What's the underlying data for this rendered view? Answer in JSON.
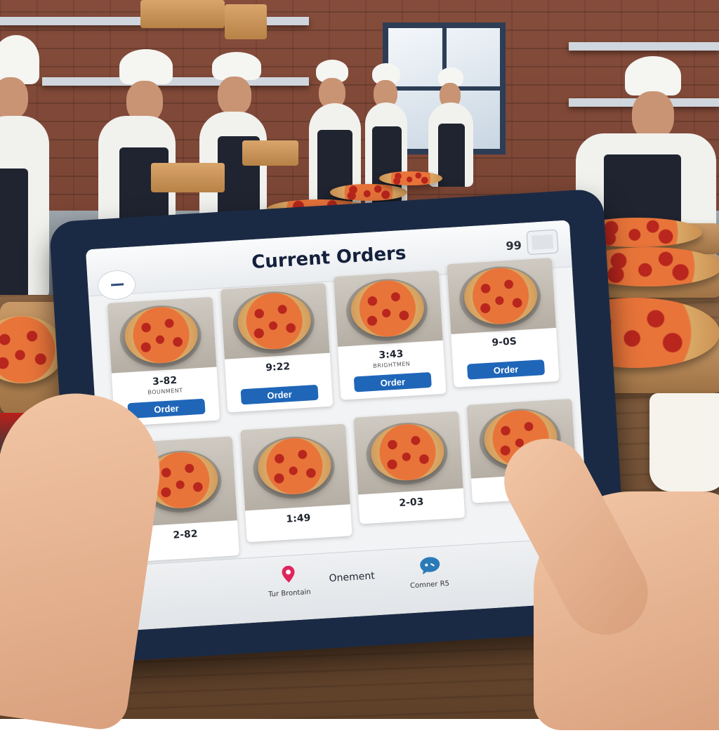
{
  "header": {
    "title": "Current Orders",
    "count": "99"
  },
  "orders": [
    {
      "time": "3-82",
      "subtitle": "BOUNMENT",
      "button": "Order"
    },
    {
      "time": "9:22",
      "subtitle": "",
      "button": "Order"
    },
    {
      "time": "3:43",
      "subtitle": "BRIGHTMEN",
      "button": "Order"
    },
    {
      "time": "9-0S",
      "subtitle": "",
      "button": "Order"
    },
    {
      "time": "2-82",
      "subtitle": "",
      "button": ""
    },
    {
      "time": "1:49",
      "subtitle": "",
      "button": ""
    },
    {
      "time": "2-03",
      "subtitle": "",
      "button": ""
    },
    {
      "time": "",
      "subtitle": "",
      "button": ""
    }
  ],
  "bottom_nav": {
    "left_label": "Tur Brontain",
    "center_label": "Onement",
    "right_label": "Comner R5"
  },
  "icons": {
    "menu": "menu-icon",
    "header": "grid-icon",
    "location": "location-pin-icon",
    "chat": "chat-bubble-icon"
  },
  "colors": {
    "accent": "#1f66b8",
    "title": "#14213d",
    "pin": "#e0245e"
  }
}
